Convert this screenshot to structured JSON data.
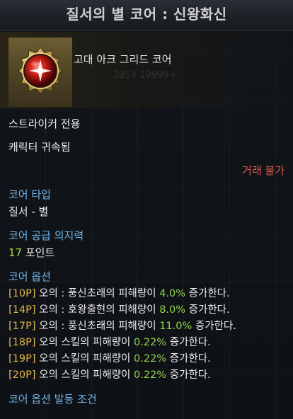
{
  "title": "질서의 별 코어 : 신왕화신",
  "item": {
    "name": "고대 아크 그리드 코어",
    "icon": "red-star-core-orb",
    "ghost_text": "3954 19999+"
  },
  "class_requirement": "스트라이커 전용",
  "bound_status": "캐릭터 귀속됨",
  "trade_status": "거래 불가",
  "core_type": {
    "label": "코어 타입",
    "value": "질서 - 별"
  },
  "willpower": {
    "label": "코어 공급 의지력",
    "amount": "17",
    "unit": " 포인트"
  },
  "options": {
    "label": "코어 옵션",
    "items": [
      {
        "tag": "[10P]",
        "pre": " 오의 : 풍신초래의 피해량이 ",
        "value": "4.0%",
        "post": " 증가한다."
      },
      {
        "tag": "[14P]",
        "pre": " 오의 : 호왕출현의 피해량이 ",
        "value": "8.0%",
        "post": " 증가한다."
      },
      {
        "tag": "[17P]",
        "pre": " 오의 : 풍신초래의 피해량이 ",
        "value": "11.0%",
        "post": " 증가한다."
      },
      {
        "tag": "[18P]",
        "pre": " 오의 스킬의 피해량이 ",
        "value": "0.22%",
        "post": " 증가한다."
      },
      {
        "tag": "[19P]",
        "pre": " 오의 스킬의 피해량이 ",
        "value": "0.22%",
        "post": " 증가한다."
      },
      {
        "tag": "[20P]",
        "pre": " 오의 스킬의 피해량이 ",
        "value": "0.22%",
        "post": " 증가한다."
      }
    ]
  },
  "next_section_label": "코어 옵션 발동 조건",
  "colors": {
    "section_heading": "#6fb3e9",
    "point_tag": "#e1b54a",
    "value_green": "#8fd24a",
    "untradeable_red": "#e0584a"
  }
}
